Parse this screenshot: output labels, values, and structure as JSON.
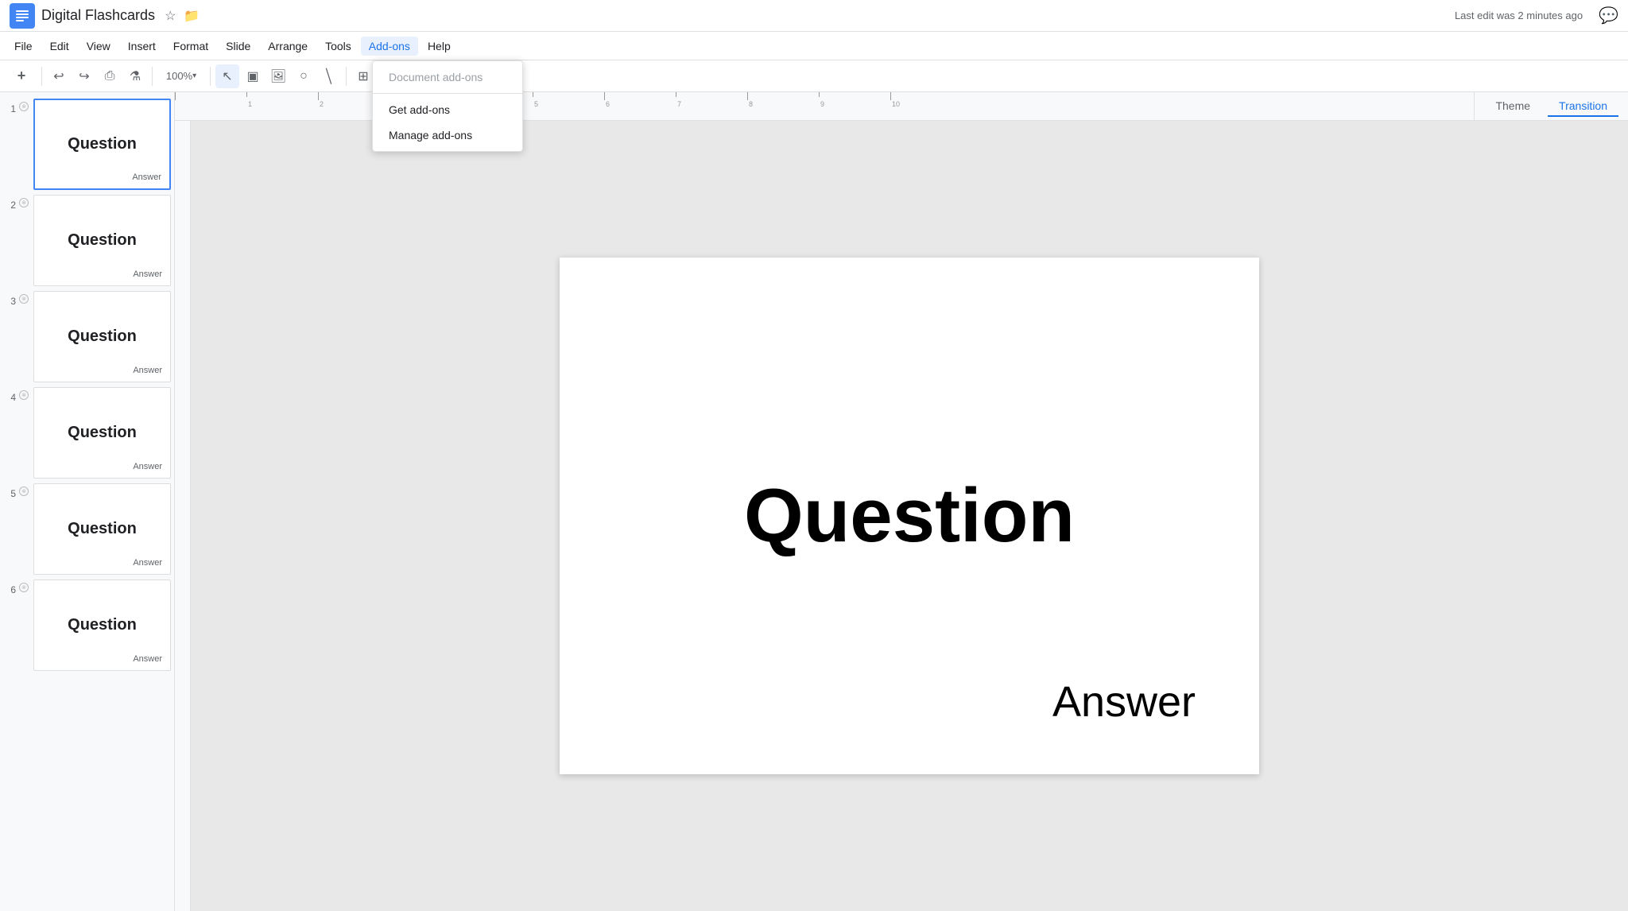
{
  "app": {
    "icon_label": "G",
    "title": "Digital Flashcards",
    "last_edit": "Last edit was 2 minutes ago"
  },
  "menubar": {
    "items": [
      {
        "id": "file",
        "label": "File"
      },
      {
        "id": "edit",
        "label": "Edit"
      },
      {
        "id": "view",
        "label": "View"
      },
      {
        "id": "insert",
        "label": "Insert"
      },
      {
        "id": "format",
        "label": "Format"
      },
      {
        "id": "slide",
        "label": "Slide"
      },
      {
        "id": "arrange",
        "label": "Arrange"
      },
      {
        "id": "tools",
        "label": "Tools"
      },
      {
        "id": "addons",
        "label": "Add-ons"
      },
      {
        "id": "help",
        "label": "Help"
      }
    ]
  },
  "toolbar": {
    "new_label": "+",
    "undo_label": "↩",
    "redo_label": "↪",
    "print_label": "⎙",
    "paintformat_label": "🖌",
    "zoom_label": "100%",
    "select_label": "↖",
    "frame_label": "▣",
    "image_label": "🖼",
    "shape_label": "○",
    "line_label": "╱",
    "addon_label": "+"
  },
  "slide_tabs": {
    "tabs": [
      {
        "id": "theme",
        "label": "Theme"
      },
      {
        "id": "transition",
        "label": "Transition"
      }
    ]
  },
  "slides": [
    {
      "num": "1",
      "question": "Question",
      "answer": "Answer",
      "selected": true
    },
    {
      "num": "2",
      "question": "Question",
      "answer": "Answer",
      "selected": false
    },
    {
      "num": "3",
      "question": "Question",
      "answer": "Answer",
      "selected": false
    },
    {
      "num": "4",
      "question": "Question",
      "answer": "Answer",
      "selected": false
    },
    {
      "num": "5",
      "question": "Question",
      "answer": "Answer",
      "selected": false
    },
    {
      "num": "6",
      "question": "Question",
      "answer": "Answer",
      "selected": false
    }
  ],
  "canvas": {
    "question": "Question",
    "answer": "Answer"
  },
  "addons_menu": {
    "items": [
      {
        "id": "document-addons",
        "label": "Document add-ons",
        "disabled": false
      },
      {
        "id": "get-addons",
        "label": "Get add-ons",
        "disabled": false
      },
      {
        "id": "manage-addons",
        "label": "Manage add-ons",
        "disabled": false
      }
    ]
  },
  "colors": {
    "accent": "#4285F4",
    "menu_active": "#e8f0fe",
    "text_primary": "#202124",
    "text_secondary": "#5f6368"
  }
}
